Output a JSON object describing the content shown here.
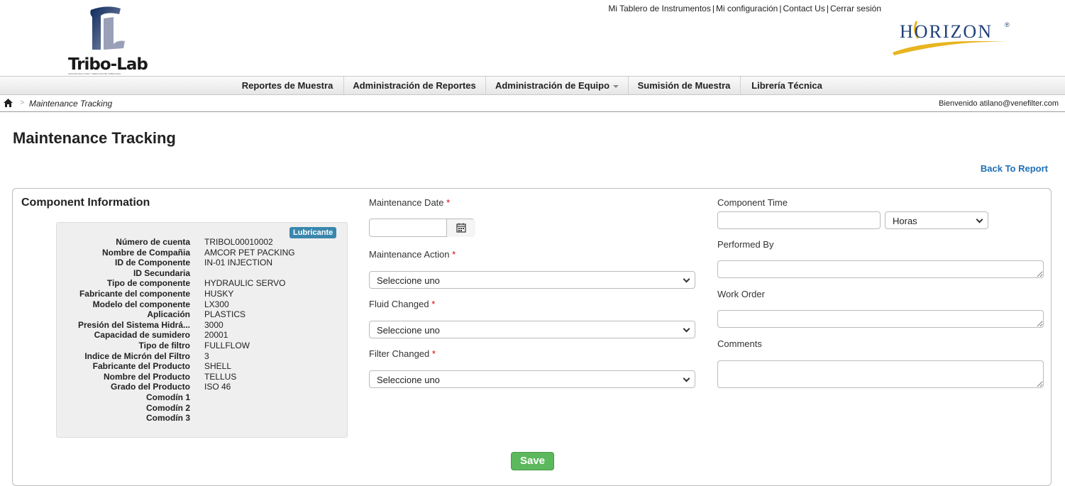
{
  "header": {
    "logo_left": {
      "name": "Tribo-Lab",
      "tagline": "ANÁLISIS DE FLUIDO Y SERVICIOS DE TRIBOLOGÍA"
    },
    "logo_right": {
      "name": "HORIZON",
      "reg_mark": "®"
    },
    "top_links": [
      {
        "label": "Mi Tablero de Instrumentos"
      },
      {
        "label": "Mi configuración"
      },
      {
        "label": "Contact Us"
      },
      {
        "label": "Cerrar sesión"
      }
    ]
  },
  "nav": {
    "items": [
      {
        "label": "Reportes de Muestra"
      },
      {
        "label": "Administración de Reportes"
      },
      {
        "label": "Administración de Equipo"
      },
      {
        "label": "Sumisión de Muestra"
      },
      {
        "label": "Librería Técnica"
      }
    ]
  },
  "breadcrumb": {
    "home_icon": "home-icon",
    "current": "Maintenance Tracking",
    "welcome": "Bienvenido atilano@venefilter.com"
  },
  "page": {
    "title": "Maintenance Tracking",
    "back_link": "Back To Report"
  },
  "component_info": {
    "title": "Component Information",
    "badge": "Lubricante",
    "rows": [
      {
        "k": "Número de cuenta",
        "v": "TRIBOL00010002"
      },
      {
        "k": "Nombre de Compañia",
        "v": "AMCOR PET PACKING"
      },
      {
        "k": "ID de Componente",
        "v": "IN-01 INJECTION"
      },
      {
        "k": "ID Secundaria",
        "v": ""
      },
      {
        "k": "Tipo de componente",
        "v": "HYDRAULIC SERVO"
      },
      {
        "k": "Fabricante del componente",
        "v": "HUSKY"
      },
      {
        "k": "Modelo del componente",
        "v": "LX300"
      },
      {
        "k": "Aplicación",
        "v": "PLASTICS"
      },
      {
        "k": "Presión del Sistema Hidrá...",
        "v": "3000"
      },
      {
        "k": "Capacidad de sumidero",
        "v": "20001"
      },
      {
        "k": "Tipo de filtro",
        "v": "FULLFLOW"
      },
      {
        "k": "Indice de Micrón del Filtro",
        "v": "3"
      },
      {
        "k": "Fabricante del Producto",
        "v": "SHELL"
      },
      {
        "k": "Nombre del Producto",
        "v": "TELLUS"
      },
      {
        "k": "Grado del Producto",
        "v": "ISO 46"
      },
      {
        "k": "Comodín 1",
        "v": ""
      },
      {
        "k": "Comodín 2",
        "v": ""
      },
      {
        "k": "Comodín 3",
        "v": ""
      }
    ]
  },
  "form": {
    "maintenance_date": {
      "label": "Maintenance Date",
      "value": ""
    },
    "maintenance_action": {
      "label": "Maintenance Action",
      "value": "Seleccione uno"
    },
    "fluid_changed": {
      "label": "Fluid Changed",
      "value": "Seleccione uno"
    },
    "filter_changed": {
      "label": "Filter Changed",
      "value": "Seleccione uno"
    },
    "component_time": {
      "label": "Component Time",
      "value": "",
      "unit": "Horas"
    },
    "performed_by": {
      "label": "Performed By",
      "value": ""
    },
    "work_order": {
      "label": "Work Order",
      "value": ""
    },
    "comments": {
      "label": "Comments",
      "value": ""
    },
    "required_mark": "*",
    "save_label": "Save"
  },
  "colors": {
    "link": "#1f6fb5",
    "badge": "#3a87ad",
    "save": "#5cb85c",
    "required": "#dd0000"
  }
}
